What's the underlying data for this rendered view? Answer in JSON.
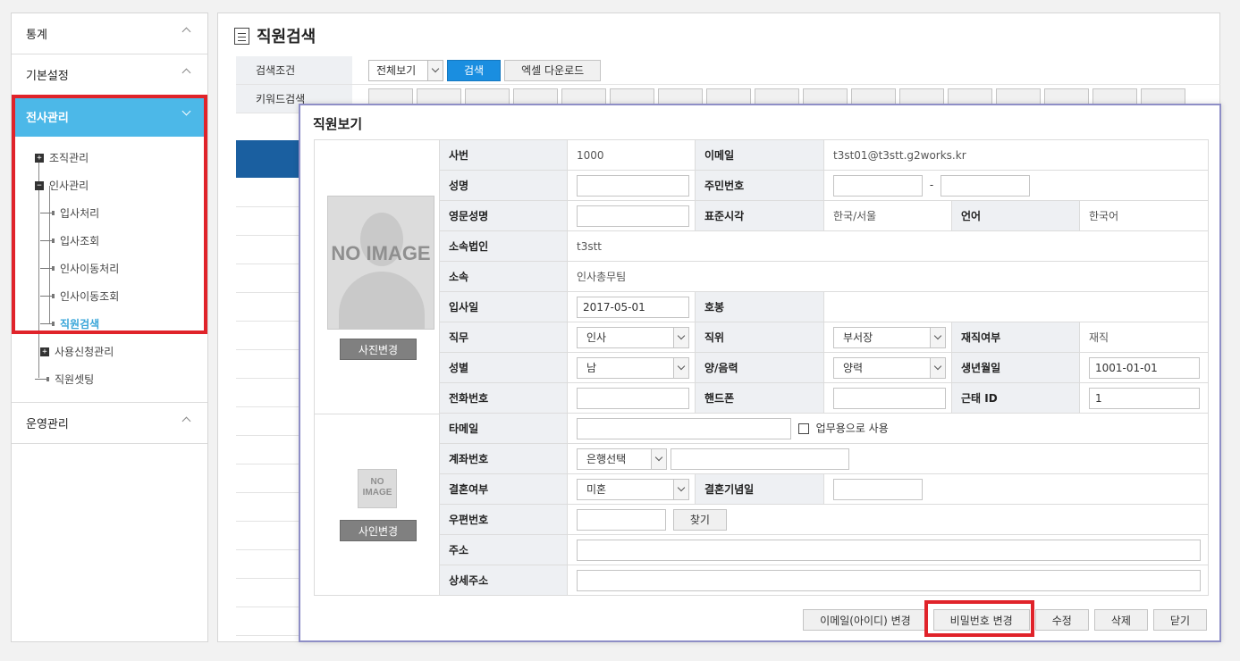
{
  "sidebar": {
    "sections": [
      {
        "label": "통계"
      },
      {
        "label": "기본설정"
      },
      {
        "label": "전사관리"
      },
      {
        "label": "운영관리"
      }
    ],
    "tree": [
      {
        "label": "조직관리",
        "toggle": "+"
      },
      {
        "label": "인사관리",
        "toggle": "−"
      },
      {
        "label": "입사처리"
      },
      {
        "label": "입사조회"
      },
      {
        "label": "인사이동처리"
      },
      {
        "label": "인사이동조회"
      },
      {
        "label": "직원검색"
      },
      {
        "label": "사용신청관리",
        "toggle": "+"
      },
      {
        "label": "직원셋팅"
      }
    ]
  },
  "main": {
    "title": "직원검색",
    "search": {
      "condition_label": "검색조건",
      "keyword_label": "키워드검색",
      "select_value": "전체보기",
      "search_button": "검색",
      "excel_button": "엑셀 다운로드"
    }
  },
  "modal": {
    "title": "직원보기",
    "photo_button": "사진변경",
    "signature_button": "사인변경",
    "no_image_text": "NO IMAGE",
    "fields": {
      "emp_no_label": "사번",
      "emp_no": "1000",
      "email_label": "이메일",
      "email": "t3st01@t3stt.g2works.kr",
      "name_label": "성명",
      "rrn_label": "주민번호",
      "rrn_sep": "-",
      "eng_name_label": "영문성명",
      "timezone_label": "표준시각",
      "timezone": "한국/서울",
      "language_label": "언어",
      "language": "한국어",
      "corp_label": "소속법인",
      "corp": "t3stt",
      "dept_label": "소속",
      "dept": "인사총무팀",
      "join_date_label": "입사일",
      "join_date": "2017-05-01",
      "grade_label": "호봉",
      "duty_label": "직무",
      "duty": "인사",
      "position_label": "직위",
      "position": "부서장",
      "status_label": "재직여부",
      "status": "재직",
      "gender_label": "성별",
      "gender": "남",
      "calendar_label": "양/음력",
      "calendar": "양력",
      "birth_label": "생년월일",
      "birth": "1001-01-01",
      "phone_label": "전화번호",
      "mobile_label": "핸드폰",
      "attendance_label": "근태 ID",
      "attendance": "1",
      "other_email_label": "타메일",
      "business_use_label": "업무용으로 사용",
      "account_label": "계좌번호",
      "bank_select": "은행선택",
      "married_label": "결혼여부",
      "married": "미혼",
      "anniversary_label": "결혼기념일",
      "zip_label": "우편번호",
      "find_button": "찾기",
      "address_label": "주소",
      "address_detail_label": "상세주소"
    },
    "actions": {
      "email_change": "이메일(아이디) 변경",
      "password_change": "비밀번호 변경",
      "edit": "수정",
      "delete": "삭제",
      "close": "닫기"
    }
  }
}
